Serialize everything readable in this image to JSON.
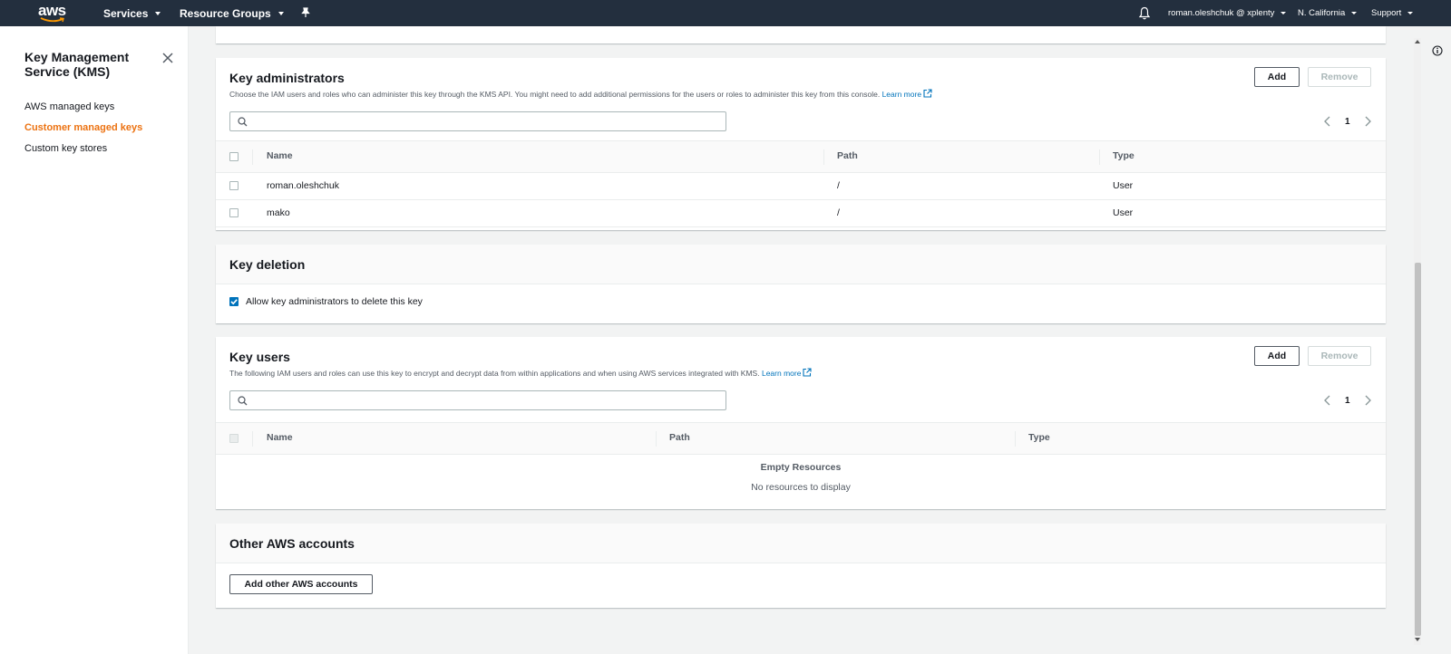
{
  "nav": {
    "logo_text": "aws",
    "services": "Services",
    "resource_groups": "Resource Groups",
    "account": "roman.oleshchuk @ xplenty",
    "region": "N. California",
    "support": "Support"
  },
  "sidebar": {
    "title": "Key Management Service (KMS)",
    "items": [
      {
        "label": "AWS managed keys",
        "active": false
      },
      {
        "label": "Customer managed keys",
        "active": true
      },
      {
        "label": "Custom key stores",
        "active": false
      }
    ]
  },
  "key_admins": {
    "title": "Key administrators",
    "description": "Choose the IAM users and roles who can administer this key through the KMS API. You might need to add additional permissions for the users or roles to administer this key from this console.",
    "learn_more": "Learn more",
    "add_label": "Add",
    "remove_label": "Remove",
    "search_placeholder": "",
    "page": "1",
    "columns": [
      "Name",
      "Path",
      "Type"
    ],
    "rows": [
      {
        "name": "roman.oleshchuk",
        "path": "/",
        "type": "User"
      },
      {
        "name": "mako",
        "path": "/",
        "type": "User"
      }
    ]
  },
  "key_deletion": {
    "title": "Key deletion",
    "checkbox_label": "Allow key administrators to delete this key",
    "checked": true
  },
  "key_users": {
    "title": "Key users",
    "description": "The following IAM users and roles can use this key to encrypt and decrypt data from within applications and when using AWS services integrated with KMS.",
    "learn_more": "Learn more",
    "add_label": "Add",
    "remove_label": "Remove",
    "search_placeholder": "",
    "page": "1",
    "columns": [
      "Name",
      "Path",
      "Type"
    ],
    "empty_title": "Empty Resources",
    "empty_message": "No resources to display"
  },
  "other_accounts": {
    "title": "Other AWS accounts",
    "button_label": "Add other AWS accounts"
  },
  "colors": {
    "nav_bg": "#232f3e",
    "accent_orange": "#ec7211",
    "link_blue": "#0073bb"
  }
}
